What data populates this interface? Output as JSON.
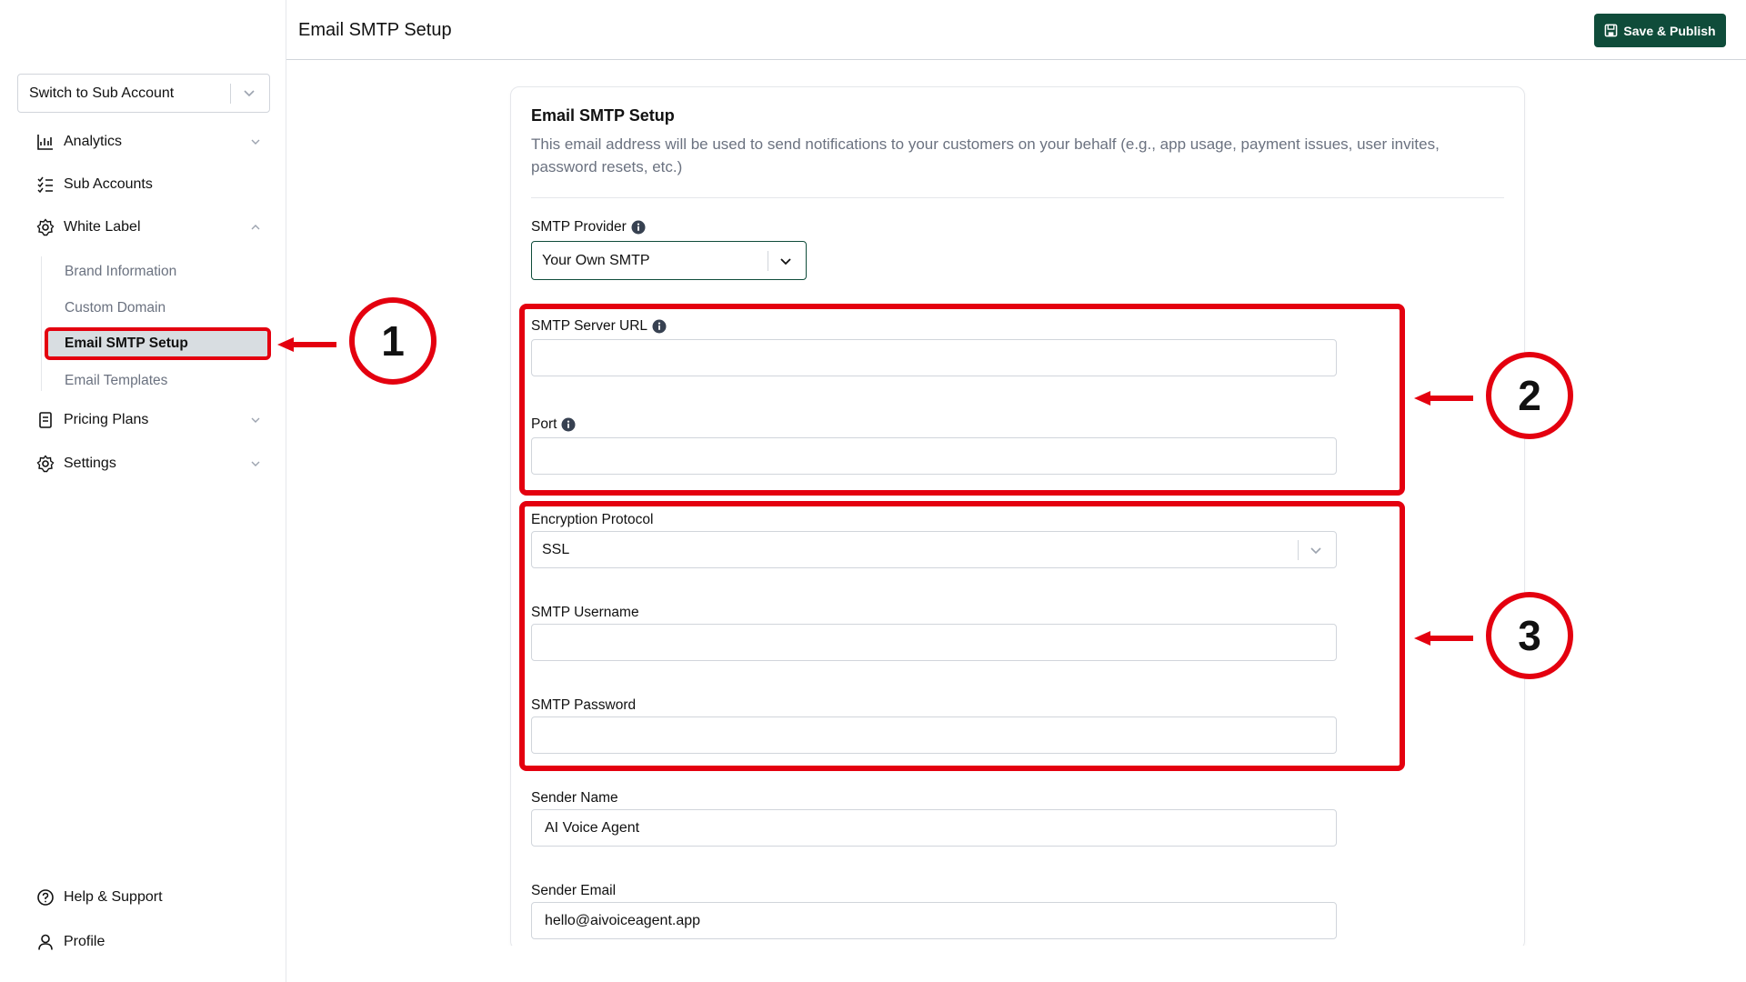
{
  "header": {
    "title": "Email SMTP Setup",
    "save_label": "Save & Publish"
  },
  "sidebar": {
    "switch_label": "Switch to Sub Account",
    "items": [
      {
        "label": "Analytics"
      },
      {
        "label": "Sub Accounts"
      },
      {
        "label": "White Label"
      },
      {
        "label": "Pricing Plans"
      },
      {
        "label": "Settings"
      }
    ],
    "white_label_sub": [
      {
        "label": "Brand Information"
      },
      {
        "label": "Custom Domain"
      },
      {
        "label": "Email SMTP Setup"
      },
      {
        "label": "Email Templates"
      }
    ],
    "bottom": [
      {
        "label": "Help & Support"
      },
      {
        "label": "Profile"
      }
    ]
  },
  "card": {
    "title": "Email SMTP Setup",
    "description": "This email address will be used to send notifications to your customers on your behalf (e.g., app usage, payment issues, user invites, password resets, etc.)"
  },
  "form": {
    "provider_label": "SMTP Provider",
    "provider_value": "Your Own SMTP",
    "server_url_label": "SMTP Server URL",
    "server_url_value": "",
    "port_label": "Port",
    "port_value": "",
    "encryption_label": "Encryption Protocol",
    "encryption_value": "SSL",
    "username_label": "SMTP Username",
    "username_value": "",
    "password_label": "SMTP Password",
    "password_value": "",
    "sender_name_label": "Sender Name",
    "sender_name_value": "AI Voice Agent",
    "sender_email_label": "Sender Email",
    "sender_email_value": "hello@aivoiceagent.app"
  },
  "annotations": {
    "one": "1",
    "two": "2",
    "three": "3",
    "color": "#e4000f"
  },
  "colors": {
    "accent": "#0f4c3a",
    "active_bg": "#d8dde1"
  }
}
